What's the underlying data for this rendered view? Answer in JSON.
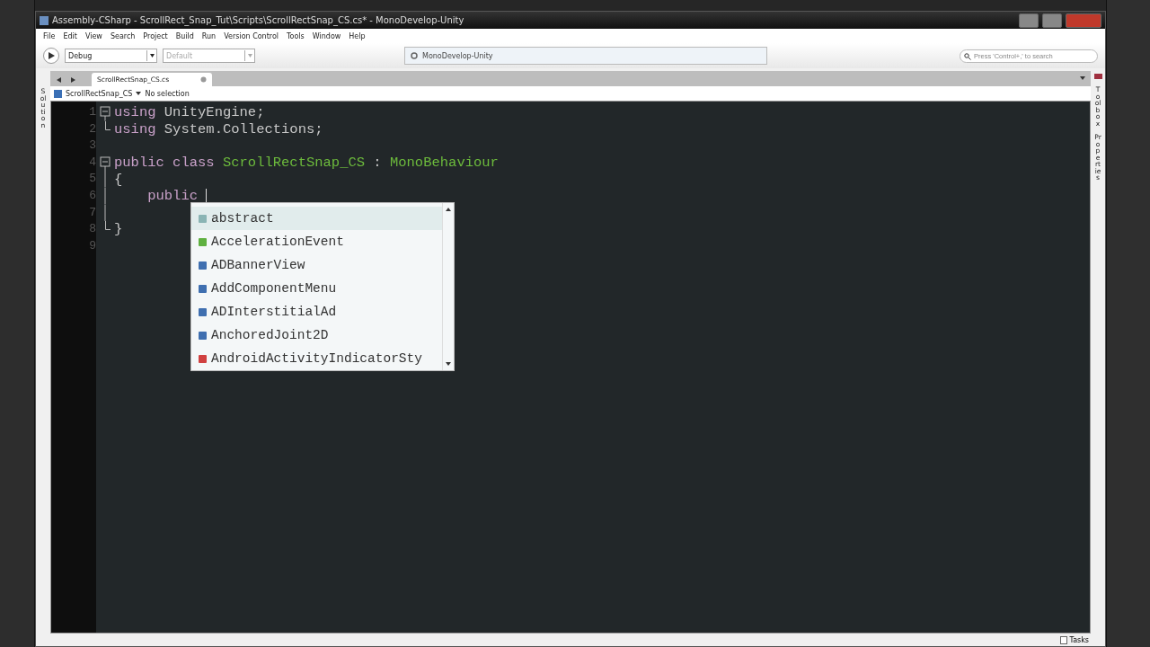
{
  "window": {
    "title": "Assembly-CSharp - ScrollRect_Snap_Tut\\Scripts\\ScrollRectSnap_CS.cs* - MonoDevelop-Unity"
  },
  "menu": [
    "File",
    "Edit",
    "View",
    "Search",
    "Project",
    "Build",
    "Run",
    "Version Control",
    "Tools",
    "Window",
    "Help"
  ],
  "toolbar": {
    "configuration": "Debug",
    "platform": "Default",
    "status": "MonoDevelop-Unity",
    "search": {
      "placeholder": "Press 'Control+,' to search"
    }
  },
  "tabs": [
    {
      "label": "ScrollRectSnap_CS.cs",
      "selected": true
    }
  ],
  "breadcrumb": {
    "class": "ScrollRectSnap_CS",
    "member": "No selection"
  },
  "left_pads": [
    "Solution"
  ],
  "right_pads": [
    "Toolbox",
    "Properties"
  ],
  "editor": {
    "lines": [
      {
        "number": "1",
        "fold_start": true,
        "tokens": [
          {
            "kind": "keyword",
            "text": "using"
          },
          {
            "kind": "plain",
            "text": " UnityEngine;"
          }
        ]
      },
      {
        "number": "2",
        "fold_end": true,
        "tokens": [
          {
            "kind": "keyword",
            "text": "using"
          },
          {
            "kind": "plain",
            "text": " System.Collections;"
          }
        ]
      },
      {
        "number": "3"
      },
      {
        "number": "4",
        "fold_start": true,
        "tokens": [
          {
            "kind": "keyword",
            "text": "public"
          },
          {
            "kind": "keyword",
            "text": " class"
          },
          {
            "kind": "type",
            "text": " ScrollRectSnap_CS"
          },
          {
            "kind": "plain",
            "text": " : "
          },
          {
            "kind": "type",
            "text": "MonoBehaviour"
          }
        ]
      },
      {
        "number": "5",
        "in_fold": true,
        "tokens": [
          {
            "kind": "plain",
            "text": "{"
          }
        ]
      },
      {
        "number": "6",
        "in_fold": true,
        "caret": true,
        "tokens": [
          {
            "kind": "keyword",
            "text": "    public"
          }
        ]
      },
      {
        "number": "7",
        "in_fold": true
      },
      {
        "number": "8",
        "fold_end": true,
        "tokens": [
          {
            "kind": "plain",
            "text": "}"
          }
        ]
      },
      {
        "number": "9"
      }
    ]
  },
  "completion": [
    {
      "label": "abstract",
      "kind": "keyword",
      "selected": true
    },
    {
      "label": "AccelerationEvent",
      "kind": "struct",
      "selected": false
    },
    {
      "label": "ADBannerView",
      "kind": "class",
      "selected": false
    },
    {
      "label": "AddComponentMenu",
      "kind": "class",
      "selected": false
    },
    {
      "label": "ADInterstitialAd",
      "kind": "class",
      "selected": false
    },
    {
      "label": "AnchoredJoint2D",
      "kind": "class",
      "selected": false
    },
    {
      "label": "AndroidActivityIndicatorSty",
      "kind": "enum",
      "selected": false
    }
  ],
  "status_bar": {
    "tasks": "Tasks"
  }
}
